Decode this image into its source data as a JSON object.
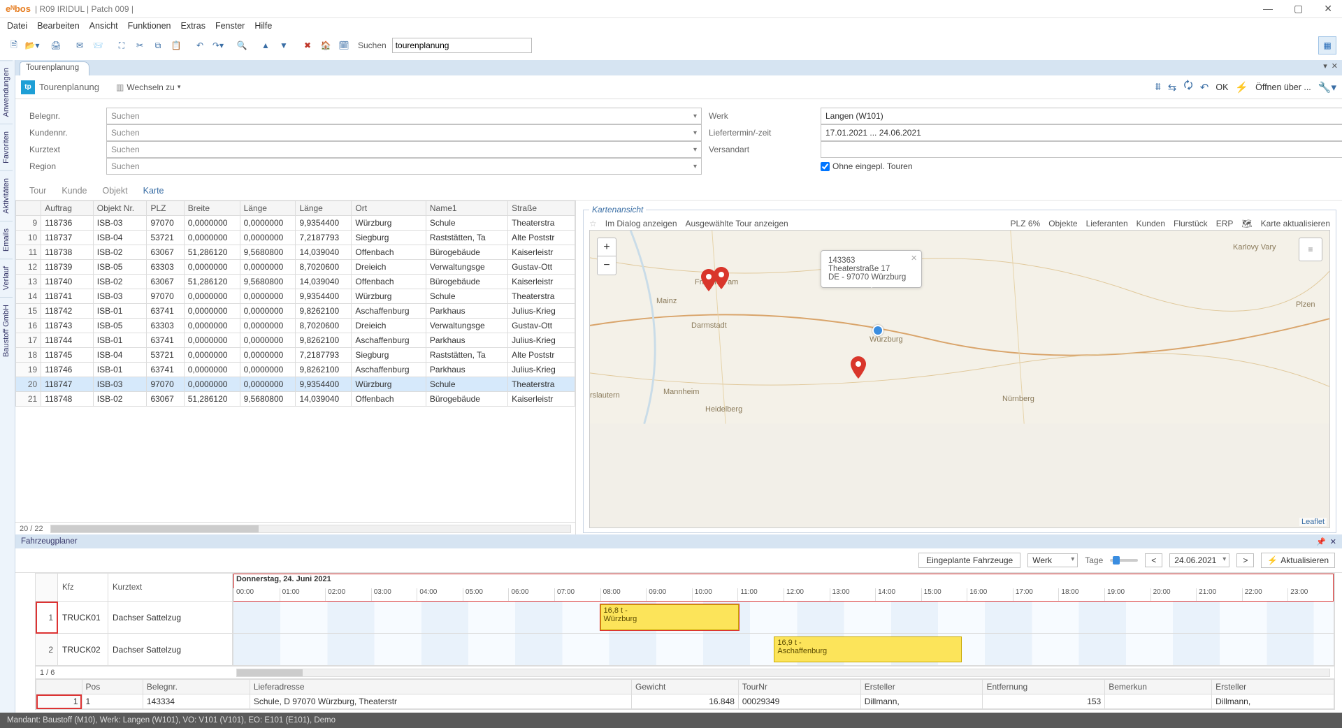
{
  "titlebar": {
    "logo": "eᴺbos",
    "title": "| R09 IRIDUL |  Patch 009 |"
  },
  "menubar": [
    "Datei",
    "Bearbeiten",
    "Ansicht",
    "Funktionen",
    "Extras",
    "Fenster",
    "Hilfe"
  ],
  "toolbar": {
    "search_label": "Suchen",
    "search_value": "tourenplanung"
  },
  "sidebar_tabs": [
    "Anwendungen",
    "Favoriten",
    "Aktivitäten",
    "Emails",
    "Verlauf",
    "Baustoff GmbH"
  ],
  "doctab": "Tourenplanung",
  "module": {
    "icon": "tp",
    "title": "Tourenplanung",
    "wechseln": "Wechseln zu",
    "right_actions": {
      "ok": "OK",
      "open_via": "Öffnen über ..."
    }
  },
  "filters": {
    "labels": {
      "belegnr": "Belegnr.",
      "kundennr": "Kundennr.",
      "kurztext": "Kurztext",
      "region": "Region",
      "werk": "Werk",
      "liefertermin": "Liefertermin/-zeit",
      "versandart": "Versandart"
    },
    "placeholder": "Suchen",
    "werk_value": "Langen (W101)",
    "liefer_value": "17.01.2021 ... 24.06.2021",
    "ohne_eingepl": "Ohne eingepl. Touren"
  },
  "subtabs": [
    "Tour",
    "Kunde",
    "Objekt",
    "Karte"
  ],
  "grid": {
    "headers": [
      "",
      "Auftrag",
      "Objekt Nr.",
      "PLZ",
      "Breite",
      "Länge",
      "Länge",
      "Ort",
      "Name1",
      "Straße"
    ],
    "rows": [
      [
        "9",
        "118736",
        "ISB-03",
        "97070",
        "0,0000000",
        "0,0000000",
        "9,9354400",
        "Würzburg",
        "Schule",
        "Theaterstra"
      ],
      [
        "10",
        "118737",
        "ISB-04",
        "53721",
        "0,0000000",
        "0,0000000",
        "7,2187793",
        "Siegburg",
        "Raststätten, Ta",
        "Alte Poststr"
      ],
      [
        "11",
        "118738",
        "ISB-02",
        "63067",
        "51,286120",
        "9,5680800",
        "14,039040",
        "Offenbach",
        "Bürogebäude",
        "Kaiserleistr"
      ],
      [
        "12",
        "118739",
        "ISB-05",
        "63303",
        "0,0000000",
        "0,0000000",
        "8,7020600",
        "Dreieich",
        "Verwaltungsge",
        "Gustav-Ott"
      ],
      [
        "13",
        "118740",
        "ISB-02",
        "63067",
        "51,286120",
        "9,5680800",
        "14,039040",
        "Offenbach",
        "Bürogebäude",
        "Kaiserleistr"
      ],
      [
        "14",
        "118741",
        "ISB-03",
        "97070",
        "0,0000000",
        "0,0000000",
        "9,9354400",
        "Würzburg",
        "Schule",
        "Theaterstra"
      ],
      [
        "15",
        "118742",
        "ISB-01",
        "63741",
        "0,0000000",
        "0,0000000",
        "9,8262100",
        "Aschaffenburg",
        "Parkhaus",
        "Julius-Krieg"
      ],
      [
        "16",
        "118743",
        "ISB-05",
        "63303",
        "0,0000000",
        "0,0000000",
        "8,7020600",
        "Dreieich",
        "Verwaltungsge",
        "Gustav-Ott"
      ],
      [
        "17",
        "118744",
        "ISB-01",
        "63741",
        "0,0000000",
        "0,0000000",
        "9,8262100",
        "Aschaffenburg",
        "Parkhaus",
        "Julius-Krieg"
      ],
      [
        "18",
        "118745",
        "ISB-04",
        "53721",
        "0,0000000",
        "0,0000000",
        "7,2187793",
        "Siegburg",
        "Raststätten, Ta",
        "Alte Poststr"
      ],
      [
        "19",
        "118746",
        "ISB-01",
        "63741",
        "0,0000000",
        "0,0000000",
        "9,8262100",
        "Aschaffenburg",
        "Parkhaus",
        "Julius-Krieg"
      ],
      [
        "20",
        "118747",
        "ISB-03",
        "97070",
        "0,0000000",
        "0,0000000",
        "9,9354400",
        "Würzburg",
        "Schule",
        "Theaterstra"
      ],
      [
        "21",
        "118748",
        "ISB-02",
        "63067",
        "51,286120",
        "9,5680800",
        "14,039040",
        "Offenbach",
        "Bürogebäude",
        "Kaiserleistr"
      ]
    ],
    "selected_row": 11,
    "footer": "20 / 22"
  },
  "map": {
    "title": "Kartenansicht",
    "actions_left": [
      "Im Dialog anzeigen",
      "Ausgewählte Tour anzeigen"
    ],
    "actions_right": [
      "PLZ 6%",
      "Objekte",
      "Lieferanten",
      "Kunden",
      "Flurstück",
      "ERP",
      "Karte aktualisieren"
    ],
    "popup": {
      "id": "143363",
      "street": "Theaterstraße 17",
      "city": "DE - 97070 Würzburg"
    },
    "labels": {
      "frankfurt": "Frankfurt am",
      "mainz": "Mainz",
      "darmstadt": "Darmstadt",
      "wurzburg": "Würzburg",
      "mannheim": "Mannheim",
      "heidelberg": "Heidelberg",
      "nurnberg": "Nürnberg",
      "plzen": "Plzen",
      "karlovy": "Karlovy Vary",
      "slautern": "rslautern"
    },
    "leaflet": "Leaflet"
  },
  "planner": {
    "title": "Fahrzeugplaner",
    "toolbar": {
      "eingeplante": "Eingeplante Fahrzeuge",
      "werk": "Werk",
      "tage": "Tage",
      "date": "24.06.2021",
      "refresh": "Aktualisieren"
    },
    "day_label": "Donnerstag, 24. Juni 2021",
    "hours": [
      "00:00",
      "01:00",
      "02:00",
      "03:00",
      "04:00",
      "05:00",
      "06:00",
      "07:00",
      "08:00",
      "09:00",
      "10:00",
      "11:00",
      "12:00",
      "13:00",
      "14:00",
      "15:00",
      "16:00",
      "17:00",
      "18:00",
      "19:00",
      "20:00",
      "21:00",
      "22:00",
      "23:00"
    ],
    "left_headers": {
      "kfz": "Kfz",
      "kurztext": "Kurztext"
    },
    "rows": [
      {
        "n": "1",
        "kfz": "TRUCK01",
        "kurz": "Dachser Sattelzug",
        "bar": {
          "start_h": 7.8,
          "end_h": 10.75,
          "label1": "16,8 t -",
          "label2": "Würzburg"
        }
      },
      {
        "n": "2",
        "kfz": "TRUCK02",
        "kurz": "Dachser Sattelzug",
        "bar": {
          "start_h": 11.5,
          "end_h": 15.5,
          "label1": "16,9 t -",
          "label2": "Aschaffenburg"
        }
      }
    ],
    "footer": "1 / 6",
    "detail": {
      "headers": [
        "Pos",
        "Belegnr.",
        "Lieferadresse",
        "Gewicht",
        "TourNr",
        "Ersteller",
        "Entfernung",
        "Bemerkun",
        "Ersteller"
      ],
      "row": [
        "1",
        "1",
        "143334",
        "Schule, D 97070 Würzburg, Theaterstr",
        "16.848",
        "00029349",
        "Dillmann,",
        "153",
        "",
        "Dillmann,"
      ]
    }
  },
  "statusbar": "Mandant: Baustoff (M10),   Werk: Langen (W101),   VO: V101 (V101),   EO: E101 (E101), Demo"
}
